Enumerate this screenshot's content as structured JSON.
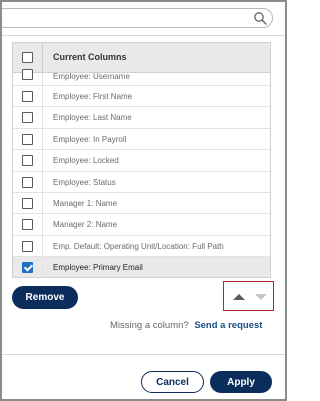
{
  "search": {
    "value": "",
    "icon": "search-icon"
  },
  "grid": {
    "header": "Current Columns",
    "rows": [
      {
        "label": "Employee: Username",
        "checked": false
      },
      {
        "label": "Employee: First Name",
        "checked": false
      },
      {
        "label": "Employee: Last Name",
        "checked": false
      },
      {
        "label": "Employee: In Payroll",
        "checked": false
      },
      {
        "label": "Employee: Locked",
        "checked": false
      },
      {
        "label": "Employee: Status",
        "checked": false
      },
      {
        "label": "Manager 1: Name",
        "checked": false
      },
      {
        "label": "Manager 2: Name",
        "checked": false
      },
      {
        "label": "Emp. Default: Operating Unit/Location: Full Path",
        "checked": false
      },
      {
        "label": "Employee: Primary Email",
        "checked": true
      }
    ]
  },
  "actions": {
    "remove_label": "Remove"
  },
  "missing": {
    "text": "Missing a column?",
    "link": "Send a request"
  },
  "footer": {
    "cancel_label": "Cancel",
    "apply_label": "Apply"
  },
  "colors": {
    "primary": "#0b2d5c",
    "checkbox_checked": "#1f6fc5",
    "highlight_border": "#b3262a",
    "link": "#1a4f86"
  }
}
